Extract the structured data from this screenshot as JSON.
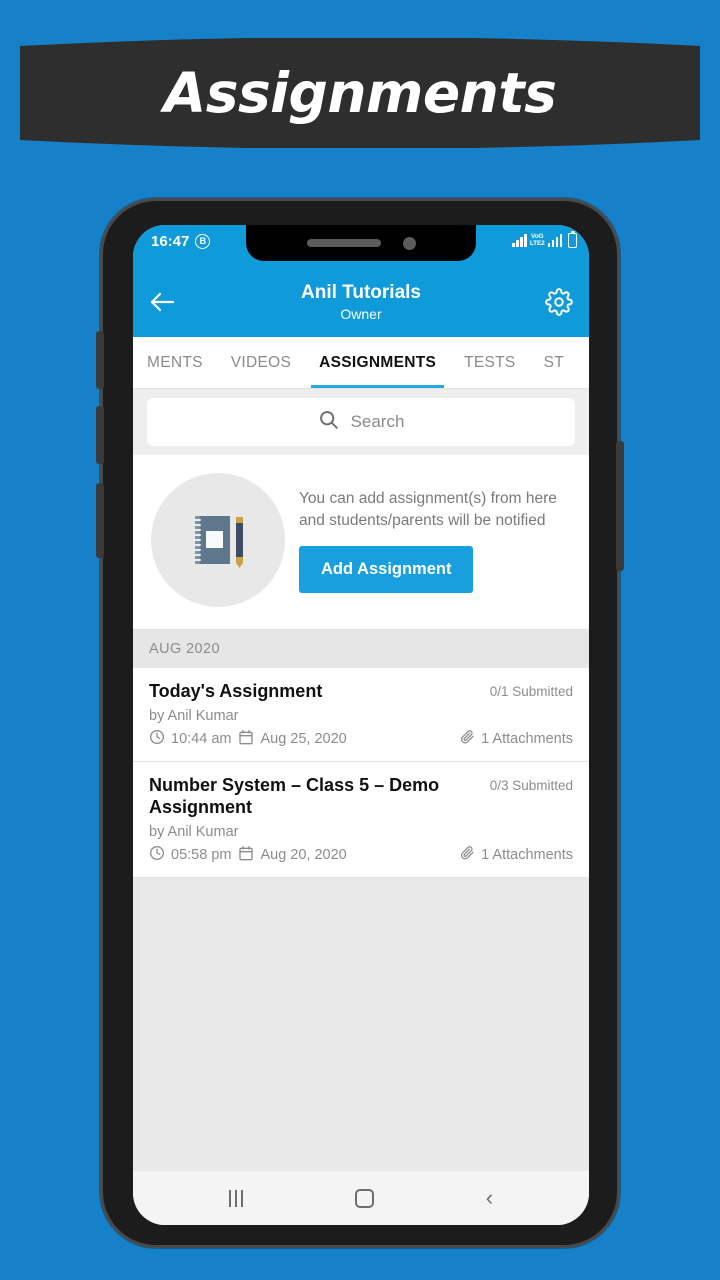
{
  "banner": {
    "title": "Assignments",
    "bg_color": "#2e2e2e",
    "text_color": "#ffffff"
  },
  "page_bg_color": "#1680c8",
  "accent_color": "#0f9ada",
  "phone": {
    "status_bar": {
      "time": "16:47",
      "bluetooth_label": "B",
      "network_label_top": "VoG",
      "network_label_bottom": "LTE2"
    },
    "app_bar": {
      "title": "Anil Tutorials",
      "subtitle": "Owner",
      "back_icon": "back-arrow-icon",
      "settings_icon": "gear-icon"
    },
    "tabs": [
      {
        "label": "MENTS",
        "active": false
      },
      {
        "label": "VIDEOS",
        "active": false
      },
      {
        "label": "ASSIGNMENTS",
        "active": true
      },
      {
        "label": "TESTS",
        "active": false
      },
      {
        "label": "ST",
        "active": false
      }
    ],
    "search": {
      "placeholder": "Search",
      "value": "",
      "icon": "search-icon"
    },
    "promo": {
      "illustration": "notebook-and-pen-icon",
      "text": "You can add assignment(s) from here and students/parents will be notified",
      "button_label": "Add Assignment",
      "button_color": "#199fdd"
    },
    "month_header": "AUG 2020",
    "assignments": [
      {
        "title": "Today's Assignment",
        "submitted": "0/1 Submitted",
        "author": "by Anil Kumar",
        "time": "10:44 am",
        "date": "Aug 25, 2020",
        "attachments": "1 Attachments"
      },
      {
        "title": "Number System – Class 5 – Demo Assignment",
        "submitted": "0/3 Submitted",
        "author": "by Anil Kumar",
        "time": "05:58 pm",
        "date": "Aug 20, 2020",
        "attachments": "1 Attachments"
      }
    ],
    "nav_bar": {
      "recents_icon": "recents-icon",
      "home_icon": "home-icon",
      "back_icon": "back-icon"
    }
  }
}
